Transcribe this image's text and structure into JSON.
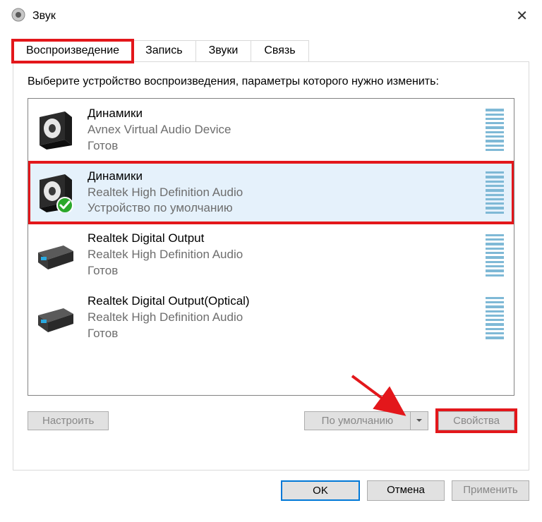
{
  "title": "Звук",
  "tabs": [
    {
      "label": "Воспроизведение",
      "active": true,
      "highlight": true
    },
    {
      "label": "Запись",
      "active": false,
      "highlight": false
    },
    {
      "label": "Звуки",
      "active": false,
      "highlight": false
    },
    {
      "label": "Связь",
      "active": false,
      "highlight": false
    }
  ],
  "instruction": "Выберите устройство воспроизведения, параметры которого нужно изменить:",
  "devices": [
    {
      "name": "Динамики",
      "description": "Avnex Virtual Audio Device",
      "status": "Готов",
      "type": "speaker",
      "selected": false,
      "highlight": false,
      "default": false
    },
    {
      "name": "Динамики",
      "description": "Realtek High Definition Audio",
      "status": "Устройство по умолчанию",
      "type": "speaker",
      "selected": true,
      "highlight": true,
      "default": true
    },
    {
      "name": "Realtek Digital Output",
      "description": "Realtek High Definition Audio",
      "status": "Готов",
      "type": "digital",
      "selected": false,
      "highlight": false,
      "default": false
    },
    {
      "name": "Realtek Digital Output(Optical)",
      "description": "Realtek High Definition Audio",
      "status": "Готов",
      "type": "digital",
      "selected": false,
      "highlight": false,
      "default": false
    }
  ],
  "panelButtons": {
    "configure": "Настроить",
    "setDefault": "По умолчанию",
    "properties": "Свойства"
  },
  "dialogButtons": {
    "ok": "OK",
    "cancel": "Отмена",
    "apply": "Применить"
  }
}
